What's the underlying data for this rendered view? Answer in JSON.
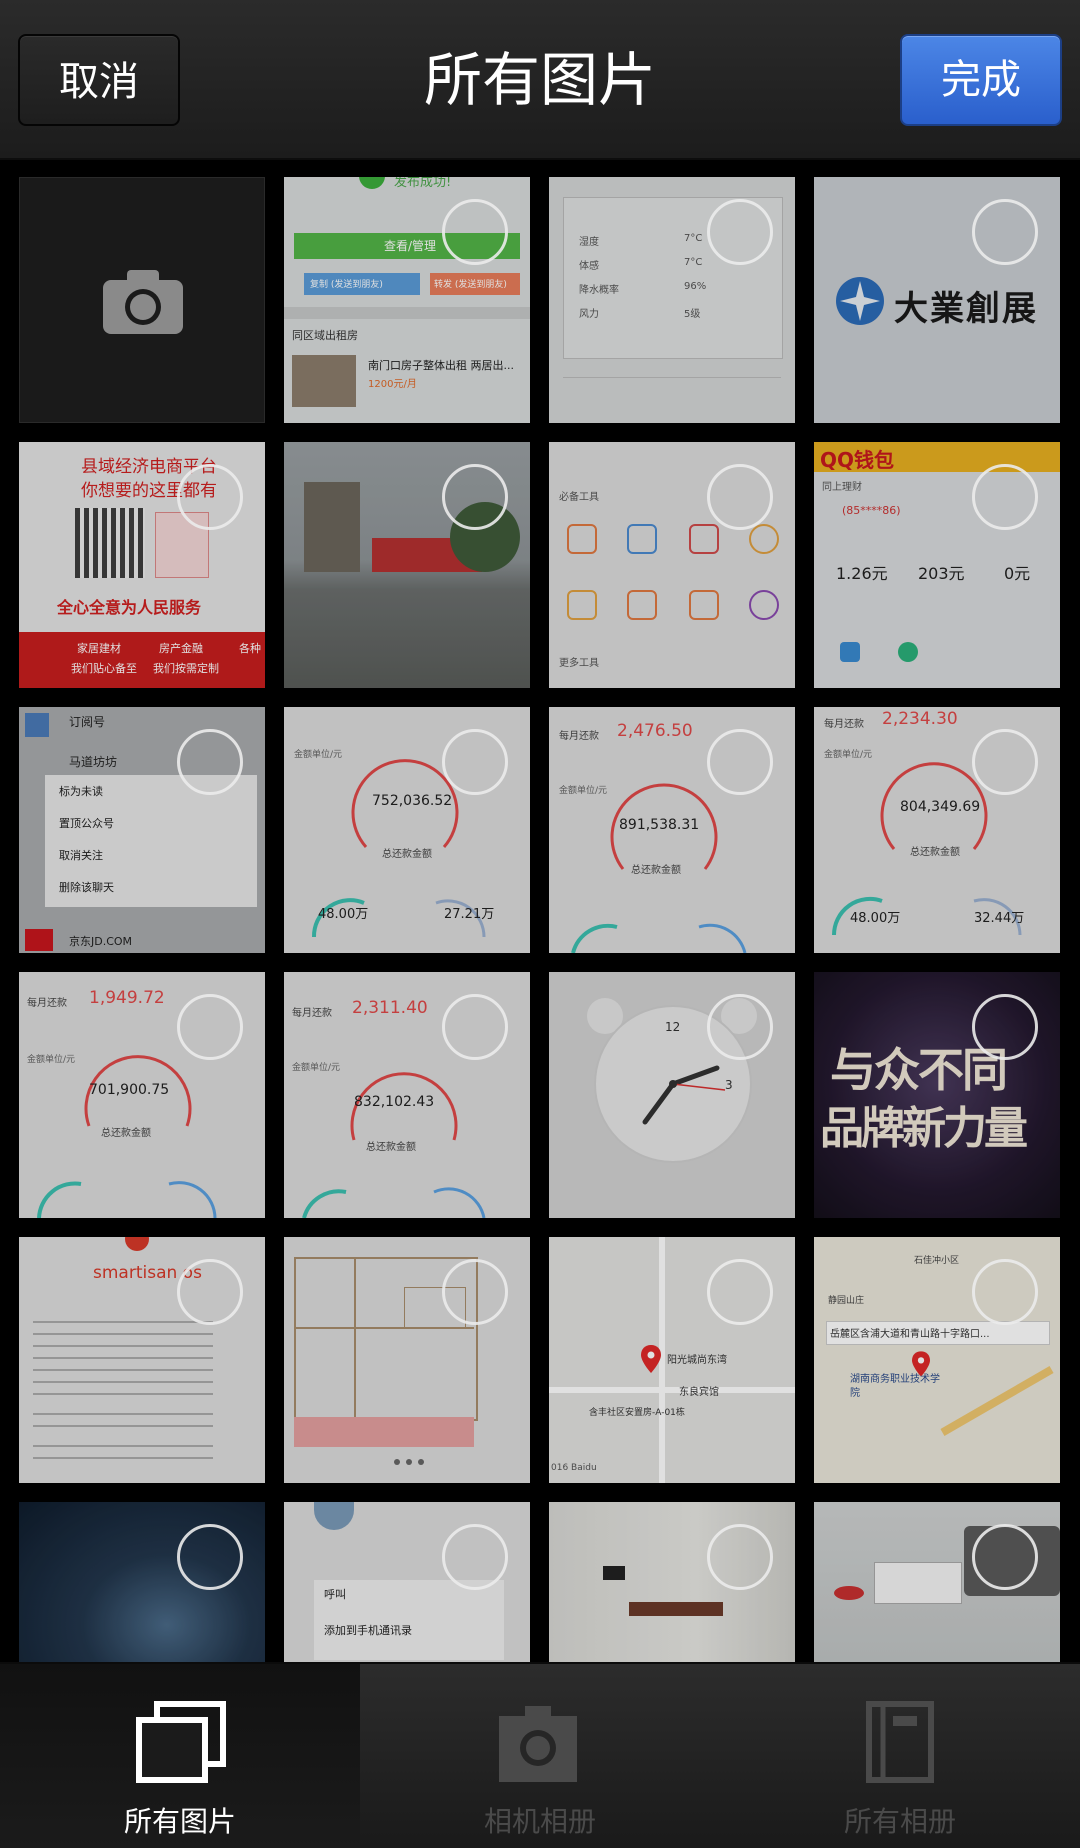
{
  "topbar": {
    "cancel_label": "取消",
    "title": "所有图片",
    "done_label": "完成"
  },
  "thumbs": {
    "t1": {
      "line1": "发布成功!",
      "btn1": "查看/管理",
      "btn2": "复制 (发送到朋友)",
      "btn3": "转发 (发送到朋友)",
      "section": "同区域出租房",
      "listing": "南门口房子整体出租 两居出...",
      "price": "1200元/月"
    },
    "t2": {
      "row1": "湿度",
      "v1": "7°C",
      "row2": "体感",
      "v2": "7°C",
      "row3": "降水概率",
      "v3": "96%",
      "row4": "风力",
      "v4": "5级"
    },
    "t3": {
      "logo_text": "大業創展"
    },
    "t4": {
      "line1": "县域经济电商平台",
      "line2": "你想要的这里都有",
      "line3": "全心全意为人民服务",
      "f1": "家居建材",
      "f2": "房产金融",
      "f3": "各种",
      "g1": "我们贴心备至",
      "g2": "我们按需定制"
    },
    "t6": {
      "section": "必备工具",
      "more": "更多工具"
    },
    "t7": {
      "banner": "QQ钱包",
      "sub": "同上理财",
      "phone": "(85****86)",
      "a1": "1.26元",
      "a2": "203元",
      "a3": "0元"
    },
    "t8": {
      "m1": "订阅号",
      "m2": "马道坊坊",
      "menu1": "标为未读",
      "menu2": "置顶公众号",
      "menu3": "取消关注",
      "menu4": "删除该聊天",
      "jd": "京东JD.COM"
    },
    "t9": {
      "unit": "金额单位/元",
      "total": "752,036.52",
      "caption": "总还款金额",
      "a": "48.00万",
      "b": "27.21万"
    },
    "t10": {
      "label": "每月还款",
      "amount": "2,476.50",
      "unit": "金额单位/元",
      "total": "891,538.31",
      "caption": "总还款金额"
    },
    "t11": {
      "label": "每月还款",
      "amount": "2,234.30",
      "unit": "金额单位/元",
      "total": "804,349.69",
      "caption": "总还款金额",
      "a": "48.00万",
      "b": "32.44万"
    },
    "t12": {
      "label": "每月还款",
      "amount": "1,949.72",
      "unit": "金额单位/元",
      "total": "701,900.75",
      "caption": "总还款金额"
    },
    "t13": {
      "label": "每月还款",
      "amount": "2,311.40",
      "unit": "金额单位/元",
      "total": "832,102.43",
      "caption": "总还款金额"
    },
    "t14": {
      "twelve": "12",
      "three": "3"
    },
    "t15": {
      "line1": "与众不同",
      "line2": "品牌新力量"
    },
    "t16": {
      "brand": "smartisan os"
    },
    "t18": {
      "place": "阳光城尚东湾",
      "poi": "东良宾馆",
      "area": "含丰社区安置房-A-01栋",
      "credit": "016 Baidu"
    },
    "t19": {
      "addr": "岳麓区含浦大道和青山路十字路口...",
      "school": "湖南商务职业技术学院",
      "p1": "静园山庄",
      "p2": "石佳冲小区"
    },
    "t21": {
      "menu1": "呼叫",
      "menu2": "添加到手机通讯录"
    }
  },
  "tabs": {
    "all_photos": "所有图片",
    "camera_roll": "相机相册",
    "all_albums": "所有相册"
  }
}
